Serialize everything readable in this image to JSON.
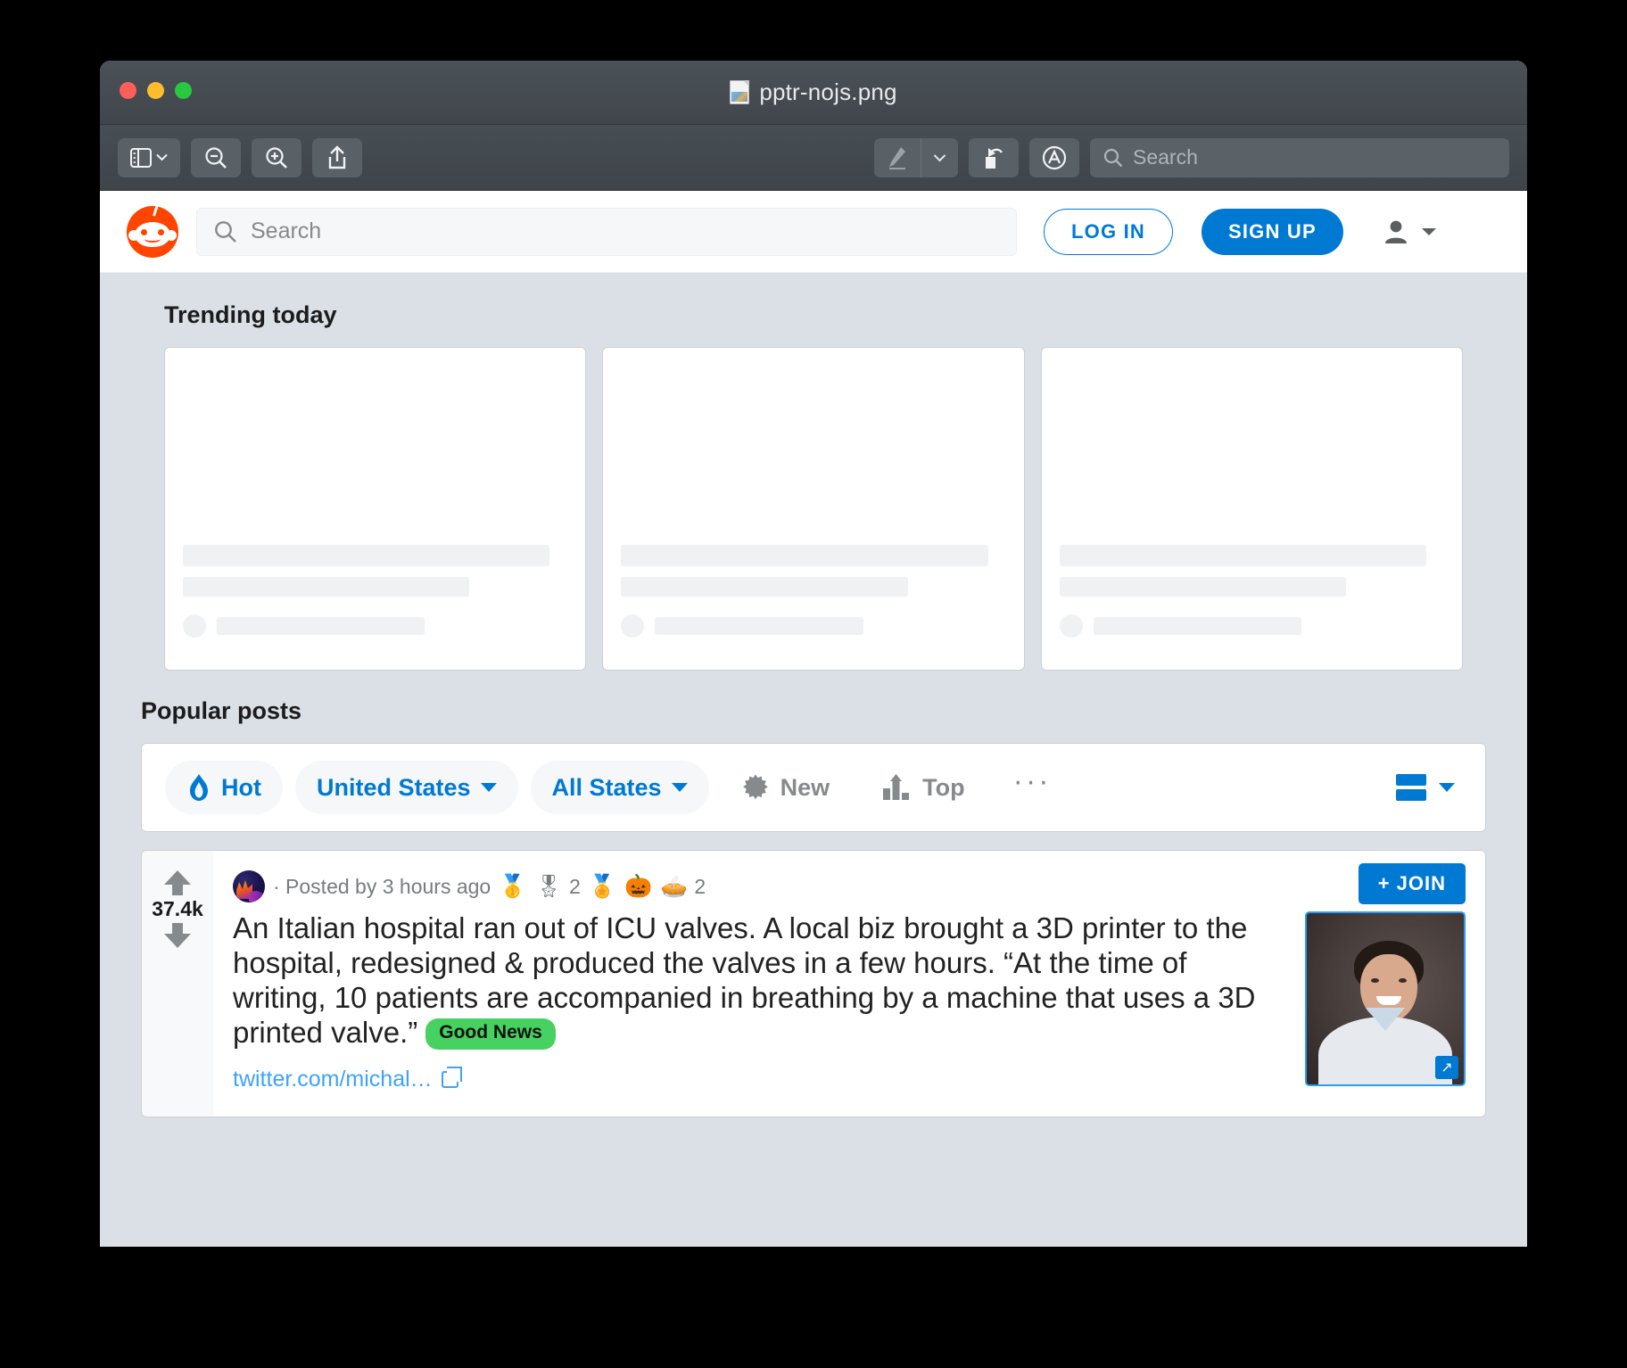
{
  "window": {
    "title": "pptr-nojs.png",
    "doc_icon": "image-file-icon",
    "traffic_lights": [
      "close-button",
      "minimize-button",
      "zoom-button"
    ]
  },
  "toolbar": {
    "sidebar_label": "sidebar-toggle",
    "zoom_out_label": "zoom-out",
    "zoom_in_label": "zoom-in",
    "share_label": "share",
    "markup_label": "markup",
    "markup_caret": "chevron-down",
    "rotate_label": "rotate",
    "annotate_label": "annotate",
    "search_placeholder": "Search"
  },
  "reddit": {
    "logo": "reddit-snoo-logo",
    "search_placeholder": "Search",
    "login_label": "LOG IN",
    "signup_label": "SIGN UP",
    "user_icon": "user-avatar-icon",
    "user_caret": "chevron-down-icon",
    "trending_title": "Trending today",
    "trending_cards": [
      {
        "id": "card-1"
      },
      {
        "id": "card-2"
      },
      {
        "id": "card-3"
      }
    ],
    "popular_title": "Popular posts",
    "filters": {
      "sort_active": "Hot",
      "sort_active_icon": "flame-icon",
      "country": "United States",
      "region": "All States",
      "new_label": "New",
      "new_icon": "sparkle-icon",
      "top_label": "Top",
      "top_icon": "bar-chart-icon",
      "more_label": "···",
      "view_icon": "card-view-icon",
      "view_caret": "chevron-down-icon",
      "accent_color": "#0079d3"
    },
    "post": {
      "vote_count": "37.4k",
      "upvote_icon": "upvote-arrow-icon",
      "downvote_icon": "downvote-arrow-icon",
      "subreddit_avatar": "subreddit-avatar",
      "meta_text": "· Posted by 3 hours ago",
      "awards": [
        {
          "icon": "🥇",
          "name": "gold-award-icon",
          "count": ""
        },
        {
          "icon": "🎖",
          "name": "silver-award-icon",
          "count": "2"
        },
        {
          "icon": "🏅",
          "name": "medal-award-icon",
          "count": ""
        },
        {
          "icon": "🎃",
          "name": "hug-award-icon",
          "count": ""
        },
        {
          "icon": "🥧",
          "name": "pie-award-icon",
          "count": "2"
        }
      ],
      "join_label": "+ JOIN",
      "title": "An Italian hospital ran out of ICU valves. A local biz brought a 3D printer to the hospital, redesigned & produced the valves in a few hours. “At the time of writing, 10 patients are accompanied in breathing by a machine that uses a 3D printed valve.”",
      "flair": "Good News",
      "flair_color": "#46d160",
      "link_text": "twitter.com/michal…",
      "link_icon": "external-link-icon",
      "thumbnail": "post-thumbnail-portrait",
      "thumbnail_expand_icon": "expand-icon"
    }
  }
}
